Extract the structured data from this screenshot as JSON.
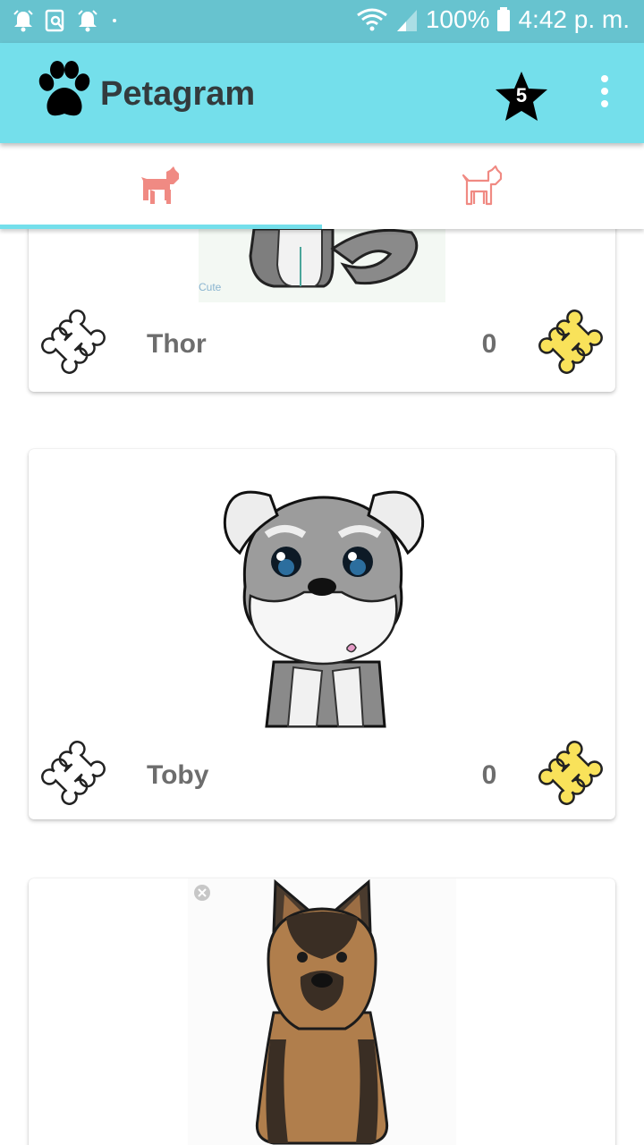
{
  "status_bar": {
    "battery": "100%",
    "time": "4:42 p. m.",
    "icons": [
      "alarm-icon",
      "screen-search-icon",
      "alarm-icon",
      "dot-icon",
      "wifi-icon",
      "signal-icon",
      "battery-icon"
    ]
  },
  "app_bar": {
    "title": "Petagram",
    "logo_icon": "paw-icon",
    "favorites_count": "5",
    "favorites_icon": "star-icon",
    "menu_icon": "more-vert-icon",
    "color": "#74dfeb"
  },
  "tabs": [
    {
      "icon": "dog-filled-icon",
      "selected": true
    },
    {
      "icon": "dog-outline-icon",
      "selected": false
    }
  ],
  "pets": [
    {
      "name": "Thor",
      "likes": "0",
      "photo_caption": "Cute"
    },
    {
      "name": "Toby",
      "likes": "0"
    },
    {
      "name": "",
      "likes": ""
    }
  ],
  "colors": {
    "status_bar": "#67c3cf",
    "accent": "#74dfeb",
    "tab_icon": "#f08a83",
    "bone_like": "#f9e25a",
    "text": "#6d6d6d"
  }
}
